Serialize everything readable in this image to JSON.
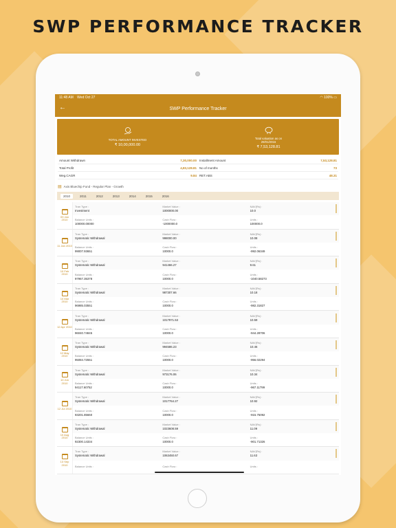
{
  "promo": {
    "title": "SWP PERFORMANCE TRACKER"
  },
  "status": {
    "time": "11:48 AM",
    "date": "Wed Oct 27",
    "battery": "100%"
  },
  "nav": {
    "title": "SWP Performance Tracker",
    "back": "←"
  },
  "summary": {
    "invested_label": "TOTAL AMOUNT INVESTED",
    "invested_value": "₹ 10,00,000.00",
    "valuation_label": "Total valuation as on 29/01/2016",
    "valuation_value": "₹ 7,53,128.81"
  },
  "stats": [
    {
      "label": "Amount Withdrawn",
      "value": "7,30,000.00",
      "label2": "Installment Amount",
      "value2": "7,53,128.81"
    },
    {
      "label": "Total Profit",
      "value": "4,83,128.81",
      "label2": "No of months",
      "value2": "73"
    },
    {
      "label": "Weg.CAGR",
      "value": "9.84",
      "label2": "RET.ABS",
      "value2": "48.31"
    }
  ],
  "fund_name": "Axis Bluechip Fund - Regular Plan - Growth",
  "years": [
    "2010",
    "2011",
    "2012",
    "2013",
    "2014",
    "2015",
    "2016"
  ],
  "labels": {
    "tran_type": "Tran Type :",
    "market_value": "Market Value :",
    "nav": "NAV(Rs) :",
    "balance_units": "Balance Units :",
    "cash_flow": "Cash Flow :",
    "units": "Units :"
  },
  "transactions": [
    {
      "date": "09 Jan 2010",
      "tran_type": "Investment",
      "market_value": "1000000.00",
      "nav": "10.0",
      "balance_units": "100000.00000",
      "cash_flow": "-1000000.0",
      "units": "100000.0"
    },
    {
      "date": "11 Jan 2010",
      "tran_type": "Systematic Withdrawal",
      "market_value": "998000.00",
      "nav": "10.08",
      "balance_units": "99007.93651",
      "cash_flow": "10000.0",
      "units": "-992.06349"
    },
    {
      "date": "10 Feb 2010",
      "tran_type": "Systematic Withdrawal",
      "market_value": "941466.27",
      "nav": "9.61",
      "balance_units": "97967.35378",
      "cash_flow": "10000.0",
      "units": "-1040.58273"
    },
    {
      "date": "10 Mar 2010",
      "tran_type": "Systematic Withdrawal",
      "market_value": "987307.66",
      "nav": "10.18",
      "balance_units": "96985.03551",
      "cash_flow": "10000.0",
      "units": "-982.31827"
    },
    {
      "date": "12 Apr 2010",
      "tran_type": "Systematic Withdrawal",
      "market_value": "1017971.53",
      "nav": "10.59",
      "balance_units": "96040.74845",
      "cash_flow": "10000.0",
      "units": "-944.28706"
    },
    {
      "date": "10 May 2010",
      "tran_type": "Systematic Withdrawal",
      "market_value": "994586.23",
      "nav": "10.46",
      "balance_units": "95084.72551",
      "cash_flow": "10000.0",
      "units": "-956.02294"
    },
    {
      "date": "10 Jun 2010",
      "tran_type": "Systematic Withdrawal",
      "market_value": "973176.06",
      "nav": "10.34",
      "balance_units": "94117.60752",
      "cash_flow": "10000.0",
      "units": "-967.11799"
    },
    {
      "date": "12 Jul 2010",
      "tran_type": "Systematic Withdrawal",
      "market_value": "1017764.27",
      "nav": "10.92",
      "balance_units": "93201.85660",
      "cash_flow": "10000.0",
      "units": "-915.75092"
    },
    {
      "date": "10 Aug 2010",
      "tran_type": "Systematic Withdrawal",
      "market_value": "1023608.59",
      "nav": "11.09",
      "balance_units": "92300.14334",
      "cash_flow": "10000.0",
      "units": "-901.71326"
    },
    {
      "date": "13 Sep 2010",
      "tran_type": "Systematic Withdrawal",
      "market_value": "1063450.67",
      "nav": "11.63",
      "balance_units": "",
      "cash_flow": "",
      "units": ""
    }
  ],
  "colors": {
    "accent": "#c58a1e",
    "background": "#f5c56e"
  }
}
